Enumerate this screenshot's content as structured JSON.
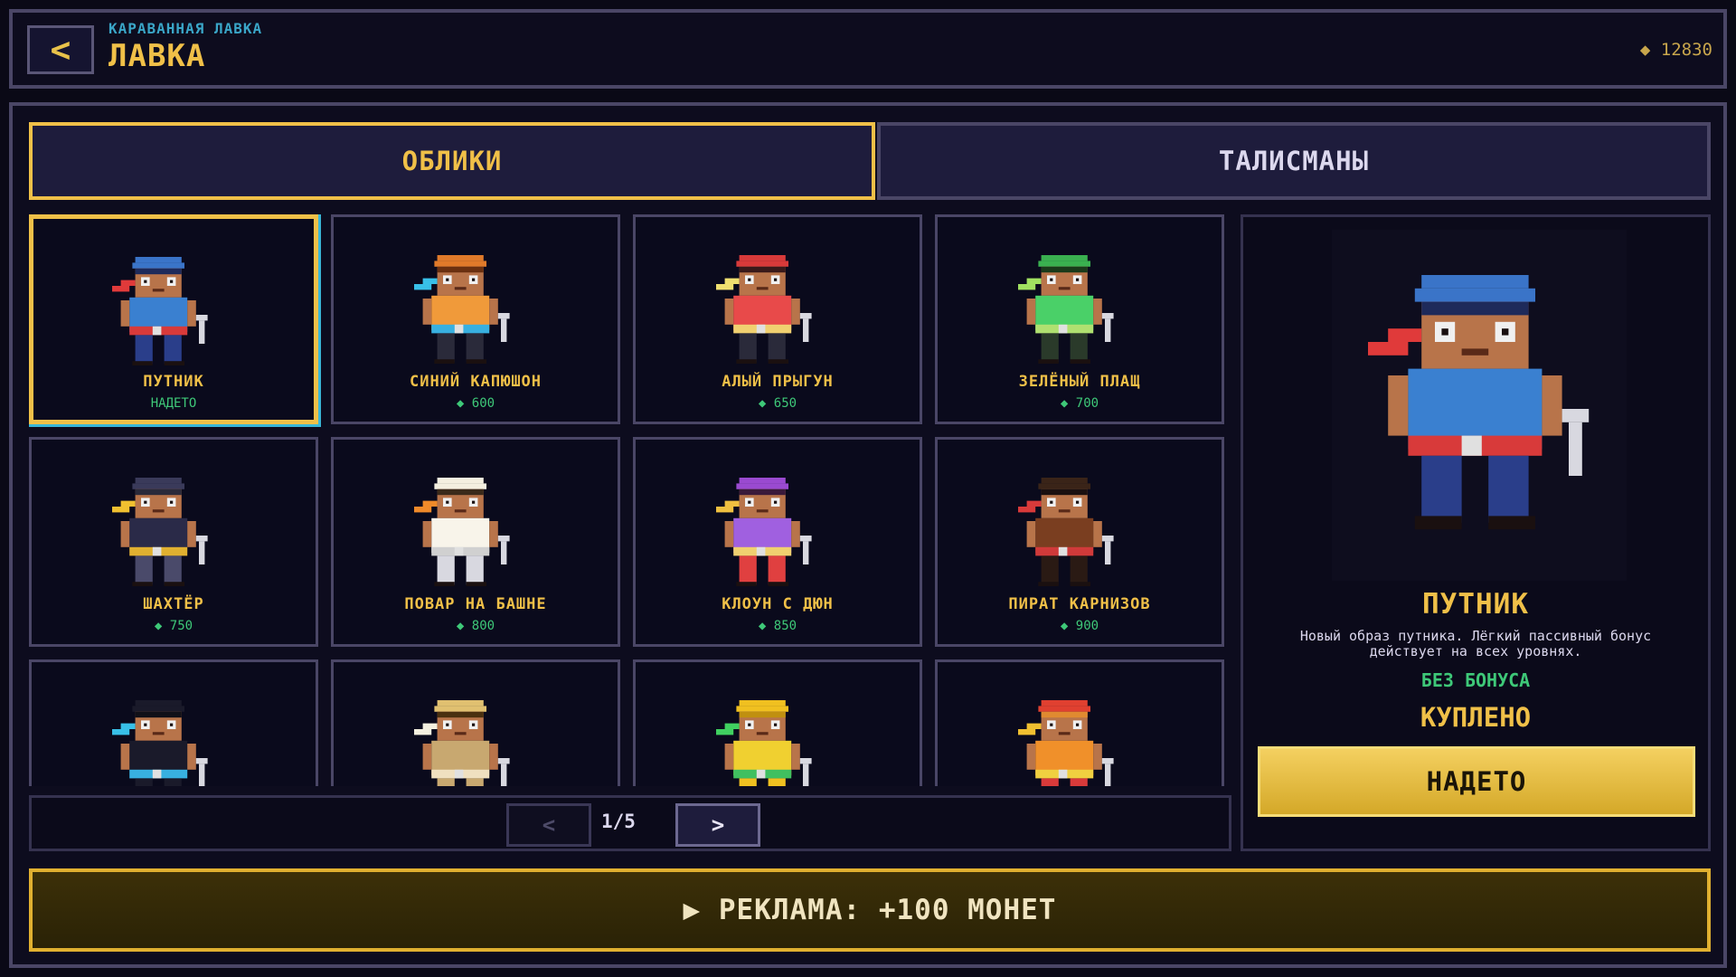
{
  "header": {
    "subtitle": "КАРАВАННАЯ ЛАВКА",
    "title": "ЛАВКА",
    "back_label": "<",
    "coins": "◆ 12830"
  },
  "tabs": [
    {
      "label": "ОБЛИКИ",
      "active": true
    },
    {
      "label": "ТАЛИСМАНЫ",
      "active": false
    }
  ],
  "colors": {
    "gold": "#f0c048",
    "green": "#3ec878",
    "cyan": "#38b6d8",
    "panel_border": "#4a4666",
    "background": "#0a0916"
  },
  "skins": [
    {
      "name": "ПУТНИК",
      "price": "НАДЕТО",
      "selected": true,
      "hat": "#3a74c8",
      "shirt": "#3a80d0",
      "belt": "#d83a3a",
      "pants": "#2a3e8a",
      "scarf": "#e03a3a",
      "hair": "#1e2a5a"
    },
    {
      "name": "СИНИЙ КАПЮШОН",
      "price": "◆ 600",
      "hat": "#e07a2a",
      "shirt": "#f09a3a",
      "belt": "#38b0e0",
      "pants": "#2a2a3a",
      "scarf": "#38c0e8",
      "hair": "#6a3010"
    },
    {
      "name": "АЛЫЙ ПРЫГУН",
      "price": "◆ 650",
      "hat": "#d83a3a",
      "shirt": "#e84a4a",
      "belt": "#f0d070",
      "pants": "#2a2a3a",
      "scarf": "#f0e070",
      "hair": "#3a1a1a"
    },
    {
      "name": "ЗЕЛЁНЫЙ ПЛАЩ",
      "price": "◆ 700",
      "hat": "#3ab050",
      "shirt": "#4ad068",
      "belt": "#b0e070",
      "pants": "#2a3a2a",
      "scarf": "#a0e060",
      "hair": "#1a3a1a"
    },
    {
      "name": "ШАХТЁР",
      "price": "◆ 750",
      "hat": "#3a3a5a",
      "shirt": "#2a2a48",
      "belt": "#e0b030",
      "pants": "#4a4a6a",
      "scarf": "#f0c030",
      "hair": "#2a2a3a"
    },
    {
      "name": "ПОВАР НА БАШНЕ",
      "price": "◆ 800",
      "hat": "#f4f0e0",
      "shirt": "#f8f4ea",
      "belt": "#d0d0d0",
      "pants": "#d8d8e0",
      "scarf": "#f08a2a",
      "hair": "#3a2a1a"
    },
    {
      "name": "КЛОУН С ДЮН",
      "price": "◆ 850",
      "hat": "#9a4ad0",
      "shirt": "#a060e0",
      "belt": "#f0d070",
      "pants": "#e04040",
      "scarf": "#f0c040",
      "hair": "#3a1a3a"
    },
    {
      "name": "ПИРАТ КАРНИЗОВ",
      "price": "◆ 900",
      "hat": "#3a2418",
      "shirt": "#7a3e20",
      "belt": "#d03a3a",
      "pants": "#2a1a14",
      "scarf": "#d83a3a",
      "hair": "#1a1010"
    },
    {
      "name": "",
      "price": "",
      "hat": "#1a1a2a",
      "shirt": "#1a1a2a",
      "belt": "#38b0e0",
      "pants": "#1a1a2a",
      "scarf": "#38c0e8",
      "hair": "#101018"
    },
    {
      "name": "",
      "price": "",
      "hat": "#e0c070",
      "shirt": "#c8a870",
      "belt": "#f0e0c0",
      "pants": "#c8a870",
      "scarf": "#f4f0e0",
      "hair": "#4a3010"
    },
    {
      "name": "",
      "price": "",
      "hat": "#f0c020",
      "shirt": "#f0d030",
      "belt": "#40c060",
      "pants": "#f0c020",
      "scarf": "#40d060",
      "hair": "#c09010"
    },
    {
      "name": "",
      "price": "",
      "hat": "#e04030",
      "shirt": "#f0902a",
      "belt": "#f0d040",
      "pants": "#d83a3a",
      "scarf": "#f0c030",
      "hair": "#e08a30"
    }
  ],
  "pager": {
    "prev": "<",
    "page": "1/5",
    "next": ">"
  },
  "detail": {
    "name": "ПУТНИК",
    "description": "Новый образ путника. Лёгкий пассивный бонус действует на всех уровнях.",
    "bonus": "БЕЗ БОНУСА",
    "status": "КУПЛЕНО",
    "button": "НАДЕТО"
  },
  "ad_button": "▶ РЕКЛАМА: +100 МОНЕТ"
}
